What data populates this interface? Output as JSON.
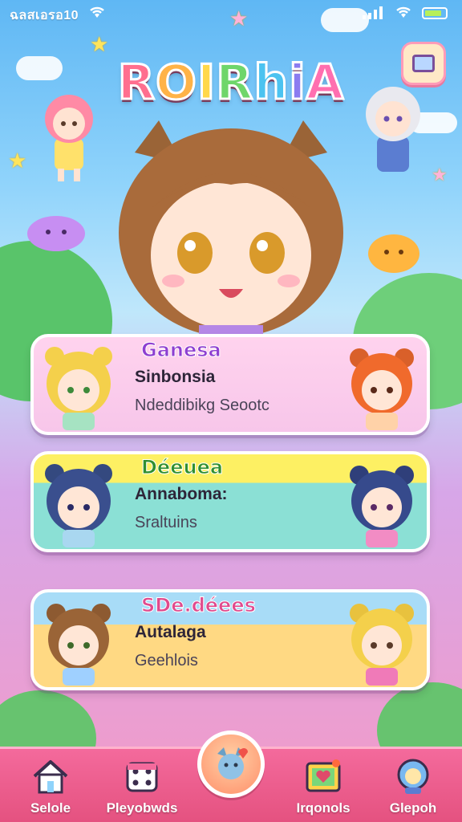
{
  "status_bar": {
    "time": "ฉลสเอรอ10"
  },
  "app": {
    "title": [
      "R",
      "O",
      "I",
      "R",
      "h",
      "i",
      "A"
    ]
  },
  "cards": [
    {
      "label": "Ganesa",
      "headline": "Sinbonsia",
      "sub": "Ndeddibikg Seootc"
    },
    {
      "label": "Déeuea",
      "headline": "Annaboma:",
      "sub": "Sraltuins"
    },
    {
      "label": "SDe.déees",
      "headline": "Autalaga",
      "sub": "Geehlois"
    }
  ],
  "nav": {
    "items": [
      {
        "label": "Selole",
        "icon": "home-icon"
      },
      {
        "label": "Pleyobwds",
        "icon": "dice-icon"
      },
      {
        "label": "Irqonols",
        "icon": "heart-frame-icon"
      },
      {
        "label": "Glepoh",
        "icon": "character-icon"
      }
    ],
    "center_icon": "cat-heart-icon"
  },
  "colors": {
    "nav": "#e4517f",
    "card1": "#f7c6ea",
    "card2_top": "#fdf063",
    "card2_bottom": "#8be0d5",
    "card3_top": "#a8dcf7",
    "card3_bottom": "#ffd983"
  }
}
